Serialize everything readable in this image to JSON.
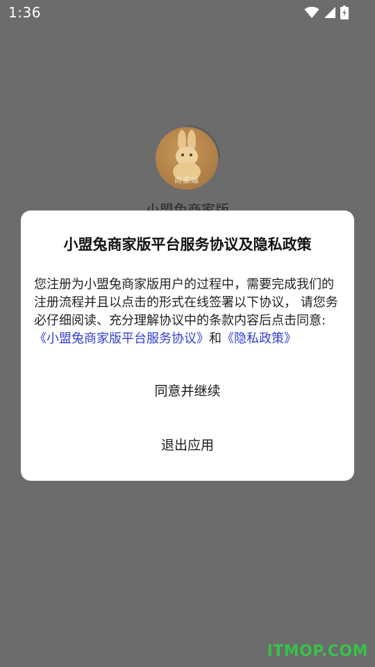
{
  "status_bar": {
    "time": "1:36",
    "icons": [
      "wifi-icon",
      "signal-icon",
      "battery-charging-icon"
    ]
  },
  "app": {
    "name": "小盟兔商家版",
    "logo_badge": "商家端"
  },
  "dialog": {
    "title": "小盟兔商家版平台服务协议及隐私政策",
    "body_text": "您注册为小盟兔商家版用户的过程中，需要完成我们的注册流程并且以点击的形式在线签署以下协议， 请您务必仔细阅读、充分理解协议中的条款内容后点击同意:",
    "link_service": "《小盟兔商家版平台服务协议》",
    "conjunction": "和",
    "link_privacy": "《隐私政策》",
    "agree_button": "同意并继续",
    "exit_button": "退出应用"
  },
  "watermark": "ITMOP.COM",
  "colors": {
    "overlay_background": "#6c6c6c",
    "dialog_background": "#ffffff",
    "link": "#2f3fd0",
    "watermark": "#37c24a"
  }
}
